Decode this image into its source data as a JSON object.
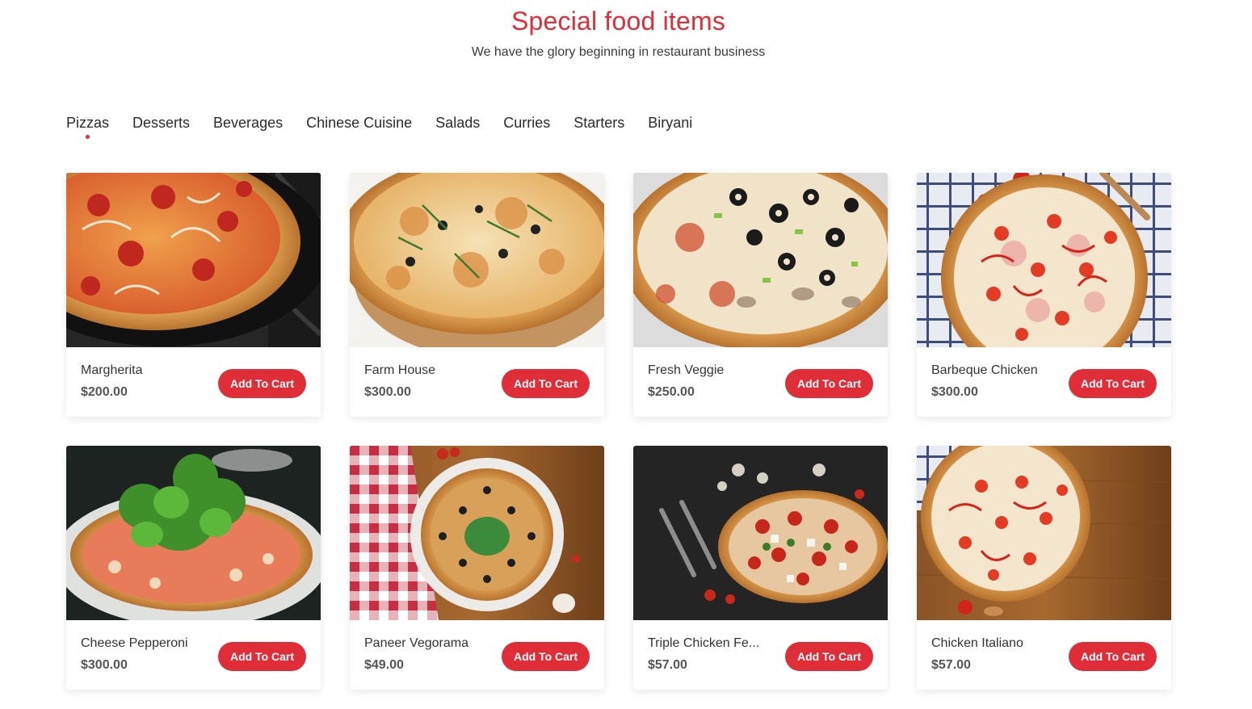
{
  "header": {
    "title": "Special food items",
    "subtitle": "We have the glory beginning in restaurant business"
  },
  "tabs": [
    {
      "label": "Pizzas",
      "active": true
    },
    {
      "label": "Desserts",
      "active": false
    },
    {
      "label": "Beverages",
      "active": false
    },
    {
      "label": "Chinese Cuisine",
      "active": false
    },
    {
      "label": "Salads",
      "active": false
    },
    {
      "label": "Curries",
      "active": false
    },
    {
      "label": "Starters",
      "active": false
    },
    {
      "label": "Biryani",
      "active": false
    }
  ],
  "products": [
    {
      "name": "Margherita",
      "price": "$200.00",
      "button": "Add To Cart",
      "image": "pizza-on-grill-photo"
    },
    {
      "name": "Farm House",
      "price": "$300.00",
      "button": "Add To Cart",
      "image": "pizza-on-board-photo"
    },
    {
      "name": "Fresh Veggie",
      "price": "$250.00",
      "button": "Add To Cart",
      "image": "olive-mushroom-pizza-photo"
    },
    {
      "name": "Barbeque Chicken",
      "price": "$300.00",
      "button": "Add To Cart",
      "image": "pizza-on-checked-cloth-photo"
    },
    {
      "name": "Cheese Pepperoni",
      "price": "$300.00",
      "button": "Add To Cart",
      "image": "arugula-pizza-photo"
    },
    {
      "name": "Paneer Vegorama",
      "price": "$49.00",
      "button": "Add To Cart",
      "image": "pizza-on-plate-photo"
    },
    {
      "name": "Triple Chicken Fe...",
      "price": "$57.00",
      "button": "Add To Cart",
      "image": "pizza-on-dark-table-photo"
    },
    {
      "name": "Chicken Italiano",
      "price": "$57.00",
      "button": "Add To Cart",
      "image": "pizza-on-wood-table-photo"
    }
  ],
  "colors": {
    "accent": "#df2e38",
    "text": "#2b2b2b"
  }
}
